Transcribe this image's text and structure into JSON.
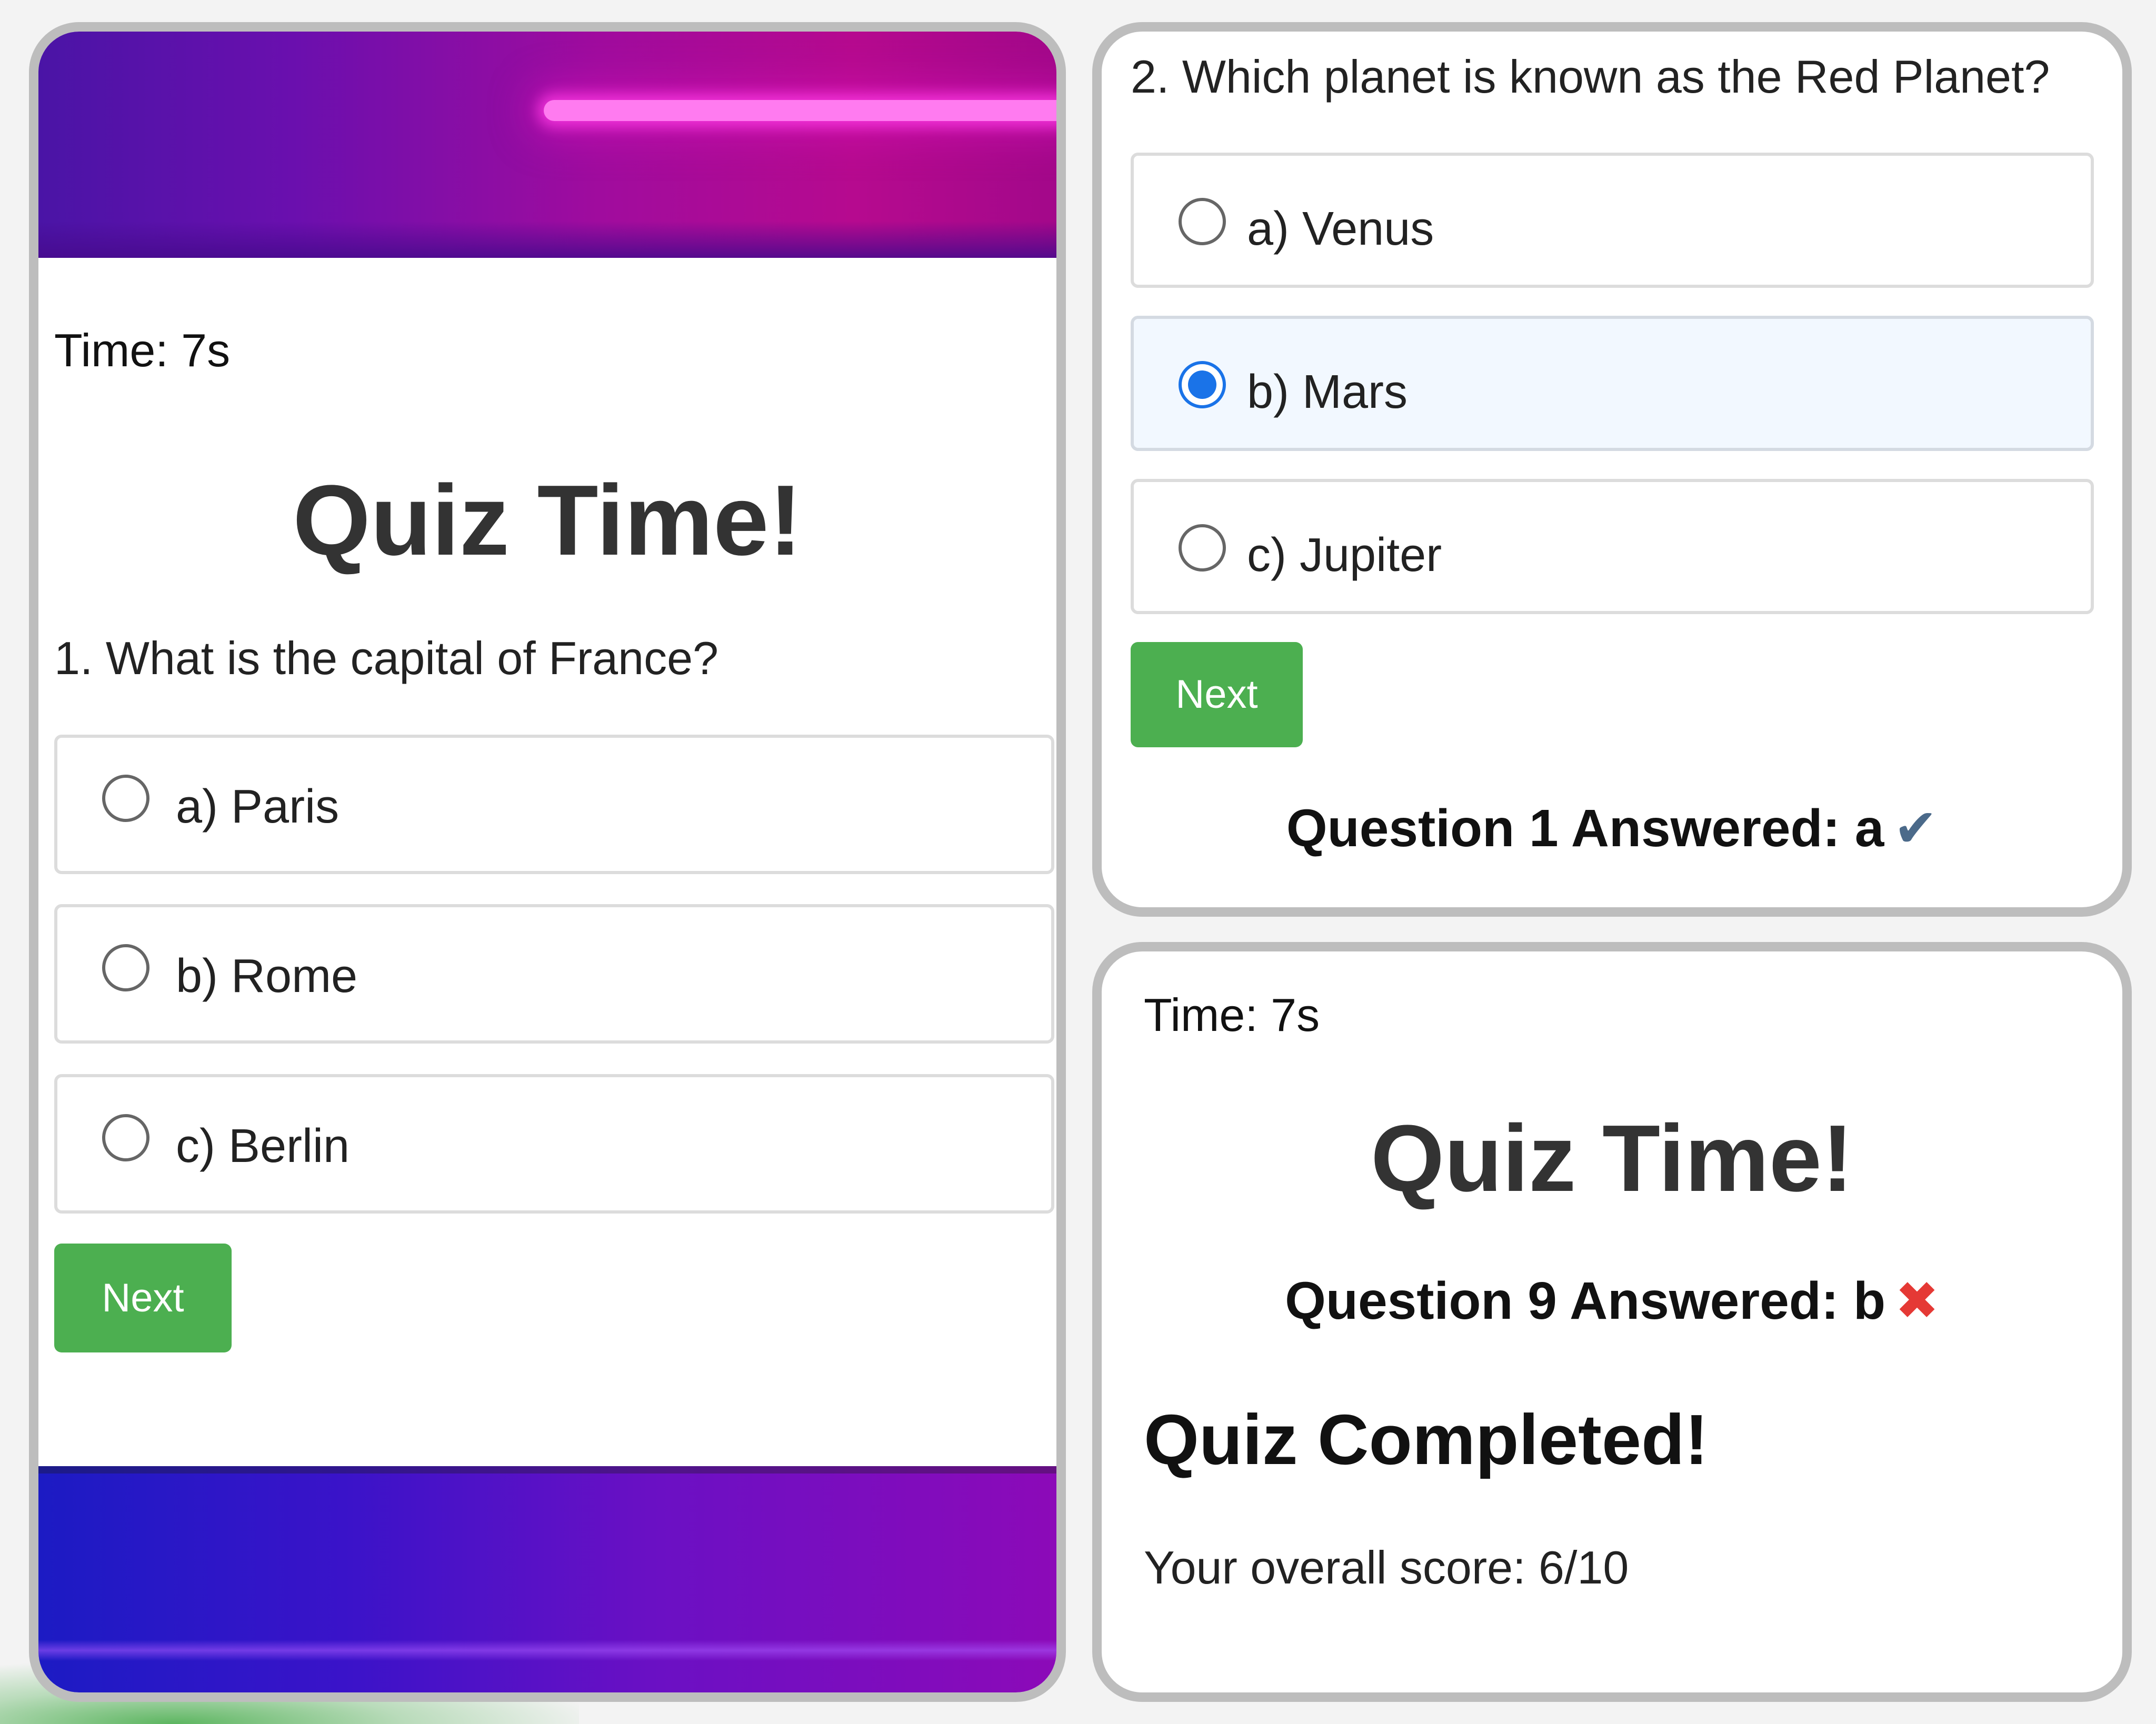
{
  "left_panel": {
    "timer": "Time: 7s",
    "title": "Quiz Time!",
    "question": "1. What is the capital of France?",
    "options": [
      {
        "label": "a) Paris",
        "selected": false
      },
      {
        "label": "b) Rome",
        "selected": false
      },
      {
        "label": "c) Berlin",
        "selected": false
      }
    ],
    "next_label": "Next"
  },
  "right_top_panel": {
    "question": "2. Which planet is known as the Red Planet?",
    "options": [
      {
        "label": "a) Venus",
        "selected": false
      },
      {
        "label": "b) Mars",
        "selected": true
      },
      {
        "label": "c) Jupiter",
        "selected": false
      }
    ],
    "next_label": "Next",
    "answered_text": "Question 1 Answered: a",
    "answered_icon": "✔"
  },
  "right_bottom_panel": {
    "timer": "Time: 7s",
    "title": "Quiz Time!",
    "answered_text": "Question 9 Answered: b",
    "answered_icon": "✖",
    "completed_heading": "Quiz Completed!",
    "score_text": "Your overall score: 6/10"
  },
  "colors": {
    "accent_green": "#4caf50",
    "radio_selected": "#1a73e8",
    "wrong_red": "#e53935",
    "option_border": "#dcdcdc"
  },
  "icons": {
    "check": "check-mark-icon",
    "cross": "cross-mark-icon"
  }
}
